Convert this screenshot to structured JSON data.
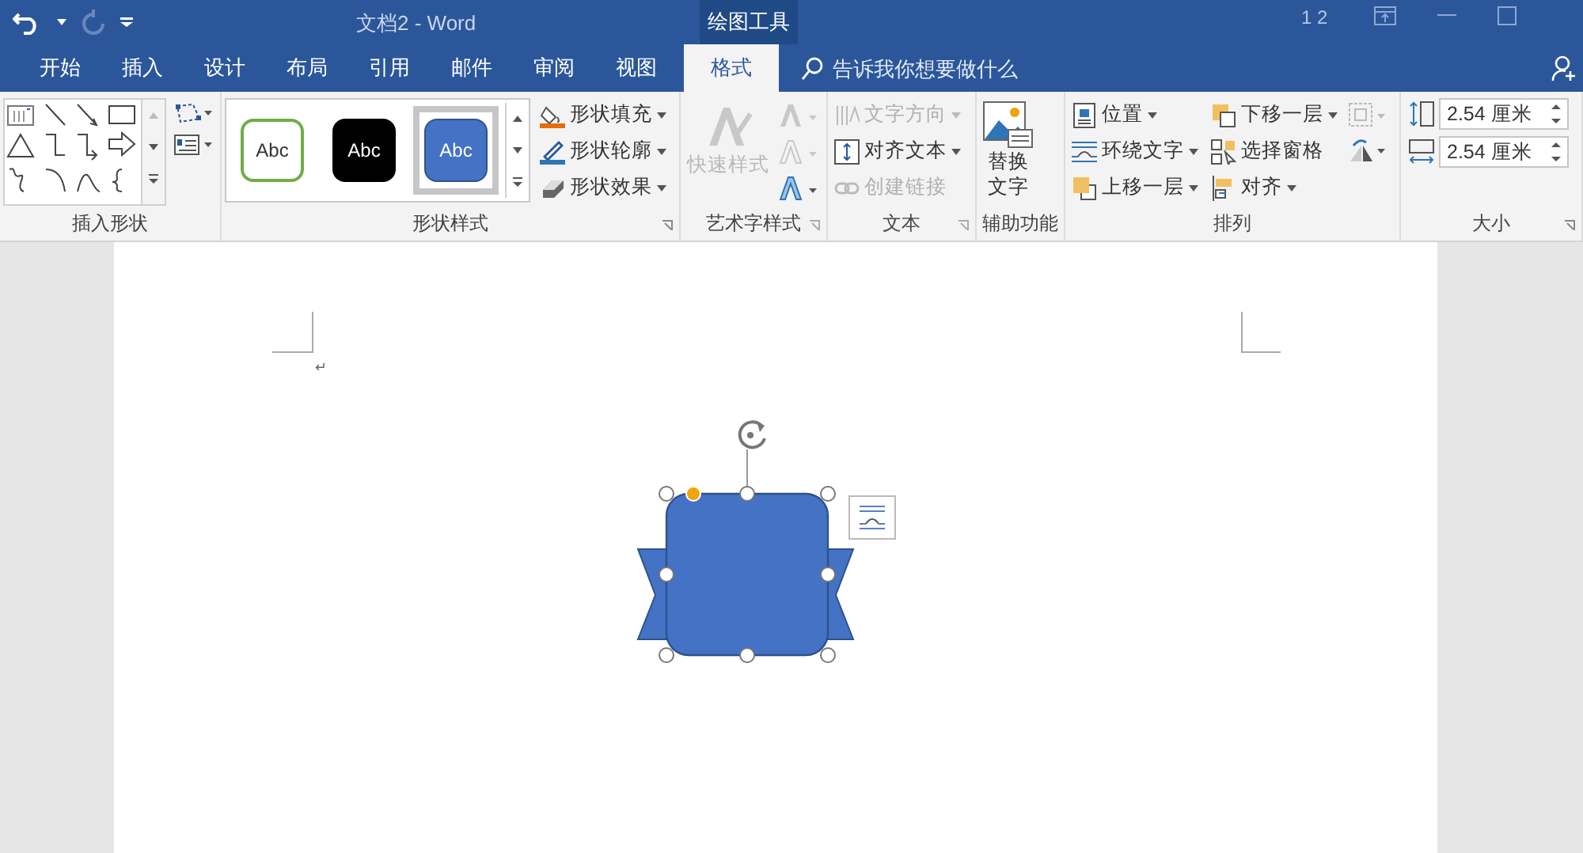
{
  "title_bar": {
    "title": "文档2  -  Word",
    "context_tab": "绘图工具",
    "page_indicator": "1 2"
  },
  "tabs": [
    {
      "label": "开始",
      "selected": false
    },
    {
      "label": "插入",
      "selected": false
    },
    {
      "label": "设计",
      "selected": false
    },
    {
      "label": "布局",
      "selected": false
    },
    {
      "label": "引用",
      "selected": false
    },
    {
      "label": "邮件",
      "selected": false
    },
    {
      "label": "审阅",
      "selected": false
    },
    {
      "label": "视图",
      "selected": false
    },
    {
      "label": "格式",
      "selected": true
    }
  ],
  "tell_me": {
    "placeholder": "告诉我你想要做什么"
  },
  "ribbon": {
    "insert_shapes": {
      "label": "插入形状"
    },
    "shape_styles": {
      "label": "形状样式",
      "presets": [
        {
          "text": "Abc",
          "kind": "outline",
          "selected": false
        },
        {
          "text": "Abc",
          "kind": "dark",
          "selected": false
        },
        {
          "text": "Abc",
          "kind": "blue",
          "selected": true
        }
      ],
      "commands": [
        {
          "label": "形状填充",
          "kind": "fill"
        },
        {
          "label": "形状轮廓",
          "kind": "outline"
        },
        {
          "label": "形状效果",
          "kind": "effect"
        }
      ]
    },
    "wordart_styles": {
      "label": "艺术字样式",
      "quick_styles": {
        "label": "快速样式",
        "disabled": true
      }
    },
    "text": {
      "label": "文本",
      "commands": [
        {
          "label": "文字方向",
          "kind": "direction",
          "disabled": true
        },
        {
          "label": "对齐文本",
          "kind": "align",
          "disabled": false
        },
        {
          "label": "创建链接",
          "kind": "link",
          "disabled": true
        }
      ]
    },
    "accessibility": {
      "label": "辅助功能",
      "alt_text": [
        "替换",
        "文字"
      ]
    },
    "arrange": {
      "label": "排列",
      "commands": [
        {
          "label": "位置",
          "kind": "position"
        },
        {
          "label": "环绕文字",
          "kind": "wrap"
        },
        {
          "label": "上移一层",
          "kind": "forward"
        },
        {
          "label": "下移一层",
          "kind": "backward"
        },
        {
          "label": "选择窗格",
          "kind": "pane"
        },
        {
          "label": "对齐",
          "kind": "align"
        }
      ]
    },
    "size": {
      "label": "大小",
      "height": "2.54 厘米",
      "width": "2.54 厘米"
    }
  },
  "document": {
    "paragraph_mark": "↵"
  }
}
